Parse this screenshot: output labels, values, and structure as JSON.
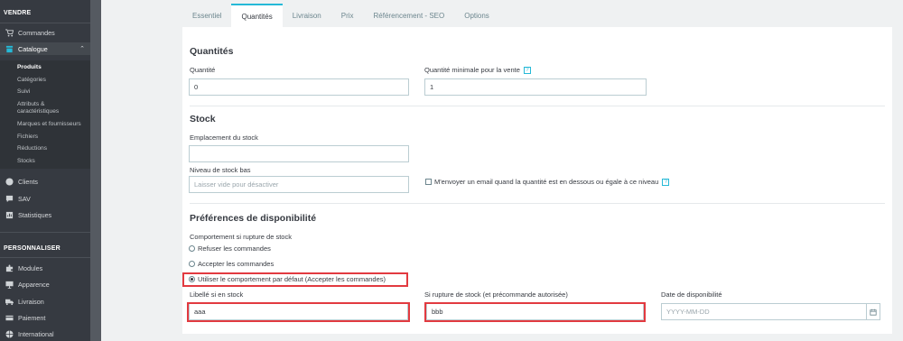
{
  "sidebar": {
    "section_sell": "VENDRE",
    "orders": "Commandes",
    "catalog": "Catalogue",
    "catalog_sub": [
      "Produits",
      "Catégories",
      "Suivi",
      "Attributs & caractéristiques",
      "Marques et fournisseurs",
      "Fichiers",
      "Réductions",
      "Stocks"
    ],
    "customers": "Clients",
    "sav": "SAV",
    "stats": "Statistiques",
    "section_customize": "PERSONNALISER",
    "modules": "Modules",
    "appearance": "Apparence",
    "shipping": "Livraison",
    "payment": "Paiement",
    "international": "International"
  },
  "tabs": [
    "Essentiel",
    "Quantités",
    "Livraison",
    "Prix",
    "Référencement - SEO",
    "Options"
  ],
  "quantities": {
    "title": "Quantités",
    "qty_label": "Quantité",
    "qty_value": "0",
    "min_qty_label": "Quantité minimale pour la vente",
    "min_qty_value": "1"
  },
  "stock": {
    "title": "Stock",
    "location_label": "Emplacement du stock",
    "location_value": "",
    "low_level_label": "Niveau de stock bas",
    "low_level_placeholder": "Laisser vide pour désactiver",
    "email_check_label": "M'envoyer un email quand la quantité est en dessous ou égale à ce niveau"
  },
  "availability": {
    "title": "Préférences de disponibilité",
    "behavior_label": "Comportement si rupture de stock",
    "options": [
      "Refuser les commandes",
      "Accepter les commandes",
      "Utiliser le comportement par défaut (Accepter les commandes)"
    ],
    "selected_index": 2,
    "in_stock_label": "Libellé si en stock",
    "in_stock_value": "aaa",
    "out_stock_label": "Si rupture de stock (et précommande autorisée)",
    "out_stock_value": "bbb",
    "date_label": "Date de disponibilité",
    "date_placeholder": "YYYY-MM-DD"
  },
  "colors": {
    "accent": "#25b9d7",
    "highlight": "#e23a40",
    "sidebar": "#363a41"
  },
  "help_glyph": "?"
}
